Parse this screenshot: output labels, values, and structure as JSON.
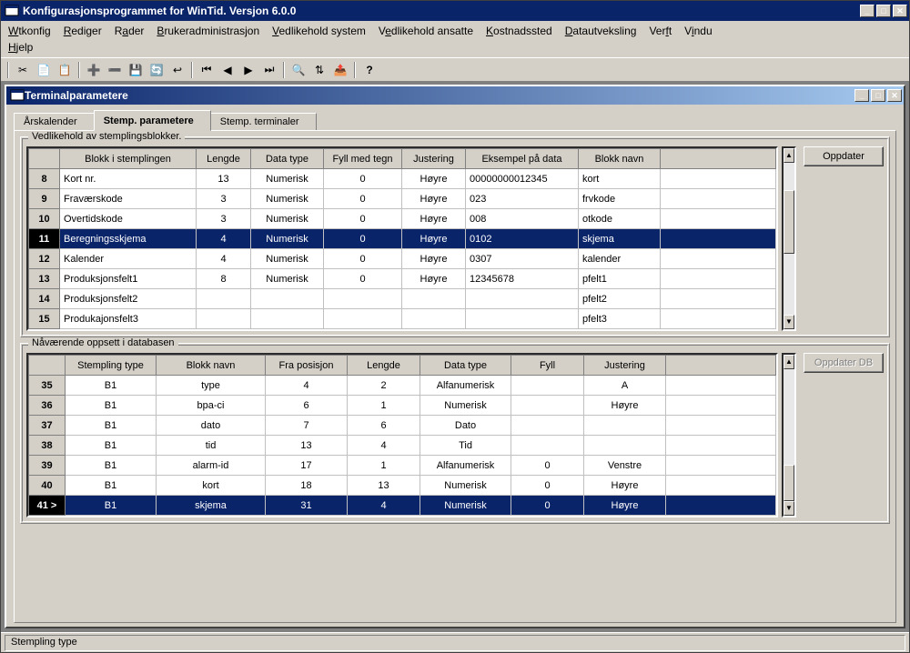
{
  "app": {
    "title": "Konfigurasjonsprogrammet for WinTid. Versjon 6.0.0"
  },
  "menu": {
    "items": [
      "Wtkonfig",
      "Rediger",
      "Rader",
      "Brukeradministrasjon",
      "Vedlikehold system",
      "Vedlikehold ansatte",
      "Kostnadssted",
      "Datautveksling",
      "Verft",
      "Vindu",
      "Hjelp"
    ]
  },
  "inner": {
    "title": "Terminalparametere"
  },
  "tabs": {
    "0": {
      "label": "Årskalender"
    },
    "1": {
      "label": "Stemp. parametere"
    },
    "2": {
      "label": "Stemp. terminaler"
    }
  },
  "group1": {
    "legend": "Vedlikehold av stemplingsblokker.",
    "button": "Oppdater",
    "cols": [
      "Blokk i stemplingen",
      "Lengde",
      "Data type",
      "Fyll med tegn",
      "Justering",
      "Eksempel på data",
      "Blokk navn"
    ],
    "rows": [
      {
        "n": "8",
        "c": [
          "Kort nr.",
          "13",
          "Numerisk",
          "0",
          "Høyre",
          "00000000012345",
          "kort"
        ],
        "sel": false
      },
      {
        "n": "9",
        "c": [
          "Fraværskode",
          "3",
          "Numerisk",
          "0",
          "Høyre",
          "023",
          "frvkode"
        ],
        "sel": false
      },
      {
        "n": "10",
        "c": [
          "Overtidskode",
          "3",
          "Numerisk",
          "0",
          "Høyre",
          "008",
          "otkode"
        ],
        "sel": false
      },
      {
        "n": "11",
        "c": [
          "Beregningsskjema",
          "4",
          "Numerisk",
          "0",
          "Høyre",
          "0102",
          "skjema"
        ],
        "sel": true
      },
      {
        "n": "12",
        "c": [
          "Kalender",
          "4",
          "Numerisk",
          "0",
          "Høyre",
          "0307",
          "kalender"
        ],
        "sel": false
      },
      {
        "n": "13",
        "c": [
          "Produksjonsfelt1",
          "8",
          "Numerisk",
          "0",
          "Høyre",
          "12345678",
          "pfelt1"
        ],
        "sel": false
      },
      {
        "n": "14",
        "c": [
          "Produksjonsfelt2",
          "",
          "",
          "",
          "",
          "",
          "pfelt2"
        ],
        "sel": false
      },
      {
        "n": "15",
        "c": [
          "Produkajonsfelt3",
          "",
          "",
          "",
          "",
          "",
          "pfelt3"
        ],
        "sel": false
      }
    ]
  },
  "group2": {
    "legend": "Nåværende oppsett i databasen",
    "button": "Oppdater DB",
    "cols": [
      "Stempling type",
      "Blokk navn",
      "Fra posisjon",
      "Lengde",
      "Data type",
      "Fyll",
      "Justering"
    ],
    "rows": [
      {
        "n": "35",
        "c": [
          "B1",
          "type",
          "4",
          "2",
          "Alfanumerisk",
          "",
          "A"
        ],
        "sel": false
      },
      {
        "n": "36",
        "c": [
          "B1",
          "bpa-ci",
          "6",
          "1",
          "Numerisk",
          "",
          "Høyre"
        ],
        "sel": false
      },
      {
        "n": "37",
        "c": [
          "B1",
          "dato",
          "7",
          "6",
          "Dato",
          "",
          ""
        ],
        "sel": false
      },
      {
        "n": "38",
        "c": [
          "B1",
          "tid",
          "13",
          "4",
          "Tid",
          "",
          ""
        ],
        "sel": false
      },
      {
        "n": "39",
        "c": [
          "B1",
          "alarm-id",
          "17",
          "1",
          "Alfanumerisk",
          "0",
          "Venstre"
        ],
        "sel": false
      },
      {
        "n": "40",
        "c": [
          "B1",
          "kort",
          "18",
          "13",
          "Numerisk",
          "0",
          "Høyre"
        ],
        "sel": false
      },
      {
        "n": "41 >",
        "c": [
          "B1",
          "skjema",
          "31",
          "4",
          "Numerisk",
          "0",
          "Høyre"
        ],
        "sel": true
      }
    ]
  },
  "status": {
    "text": "Stempling type"
  }
}
